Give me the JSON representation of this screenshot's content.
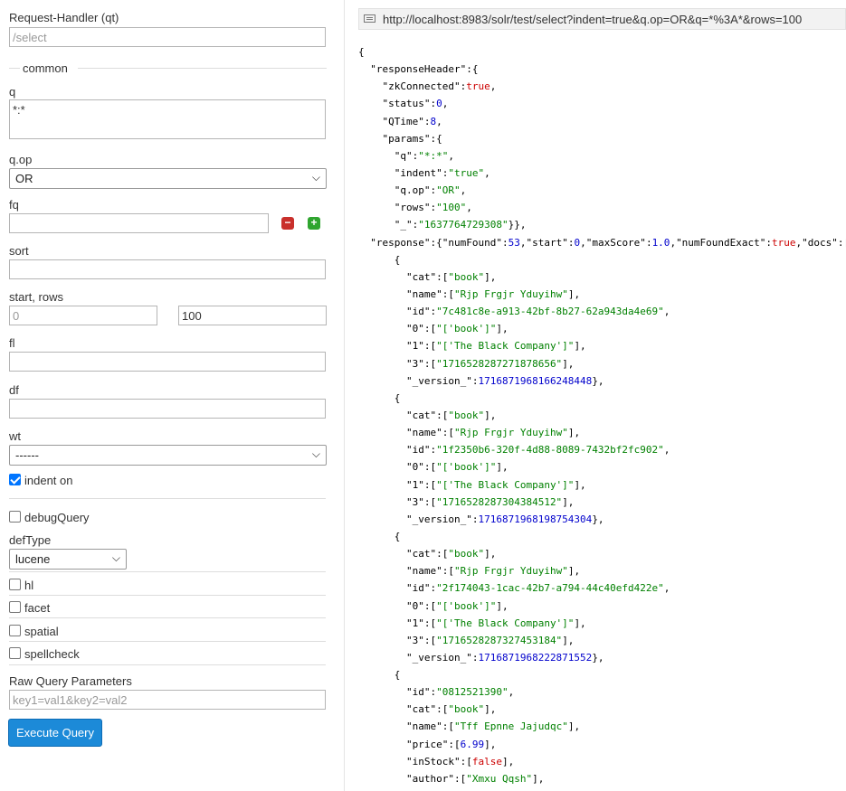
{
  "form": {
    "request_handler_label": "Request-Handler (qt)",
    "request_handler_value": "/select",
    "common_label": "common",
    "q_label": "q",
    "q_value": "*:*",
    "qop_label": "q.op",
    "qop_selected": "OR",
    "fq_label": "fq",
    "sort_label": "sort",
    "start_rows_label": "start, rows",
    "start_value": "0",
    "rows_value": "100",
    "fl_label": "fl",
    "df_label": "df",
    "wt_label": "wt",
    "wt_selected": "------",
    "indent_label": "indent on",
    "indent_checked": true,
    "debug_label": "debugQuery",
    "deftype_label": "defType",
    "deftype_selected": "lucene",
    "hl_label": "hl",
    "facet_label": "facet",
    "spatial_label": "spatial",
    "spellcheck_label": "spellcheck",
    "raw_params_label": "Raw Query Parameters",
    "raw_params_placeholder": "key1=val1&key2=val2",
    "execute_label": "Execute Query"
  },
  "response": {
    "url": "http://localhost:8983/solr/test/select?indent=true&q.op=OR&q=*%3A*&rows=100",
    "lines": [
      [
        [
          "p",
          "{"
        ]
      ],
      [
        [
          "p",
          "  "
        ],
        [
          "k",
          "\"responseHeader\""
        ],
        [
          "p",
          ":{"
        ]
      ],
      [
        [
          "p",
          "    "
        ],
        [
          "k",
          "\"zkConnected\""
        ],
        [
          "p",
          ":"
        ],
        [
          "b",
          "true"
        ],
        [
          "p",
          ","
        ]
      ],
      [
        [
          "p",
          "    "
        ],
        [
          "k",
          "\"status\""
        ],
        [
          "p",
          ":"
        ],
        [
          "n",
          "0"
        ],
        [
          "p",
          ","
        ]
      ],
      [
        [
          "p",
          "    "
        ],
        [
          "k",
          "\"QTime\""
        ],
        [
          "p",
          ":"
        ],
        [
          "n",
          "8"
        ],
        [
          "p",
          ","
        ]
      ],
      [
        [
          "p",
          "    "
        ],
        [
          "k",
          "\"params\""
        ],
        [
          "p",
          ":{"
        ]
      ],
      [
        [
          "p",
          "      "
        ],
        [
          "k",
          "\"q\""
        ],
        [
          "p",
          ":"
        ],
        [
          "s",
          "\"*:*\""
        ],
        [
          "p",
          ","
        ]
      ],
      [
        [
          "p",
          "      "
        ],
        [
          "k",
          "\"indent\""
        ],
        [
          "p",
          ":"
        ],
        [
          "s",
          "\"true\""
        ],
        [
          "p",
          ","
        ]
      ],
      [
        [
          "p",
          "      "
        ],
        [
          "k",
          "\"q.op\""
        ],
        [
          "p",
          ":"
        ],
        [
          "s",
          "\"OR\""
        ],
        [
          "p",
          ","
        ]
      ],
      [
        [
          "p",
          "      "
        ],
        [
          "k",
          "\"rows\""
        ],
        [
          "p",
          ":"
        ],
        [
          "s",
          "\"100\""
        ],
        [
          "p",
          ","
        ]
      ],
      [
        [
          "p",
          "      "
        ],
        [
          "k",
          "\"_\""
        ],
        [
          "p",
          ":"
        ],
        [
          "s",
          "\"1637764729308\""
        ],
        [
          "p",
          "}},"
        ]
      ],
      [
        [
          "p",
          "  "
        ],
        [
          "k",
          "\"response\""
        ],
        [
          "p",
          ":{"
        ],
        [
          "k",
          "\"numFound\""
        ],
        [
          "p",
          ":"
        ],
        [
          "n",
          "53"
        ],
        [
          "p",
          ","
        ],
        [
          "k",
          "\"start\""
        ],
        [
          "p",
          ":"
        ],
        [
          "n",
          "0"
        ],
        [
          "p",
          ","
        ],
        [
          "k",
          "\"maxScore\""
        ],
        [
          "p",
          ":"
        ],
        [
          "n",
          "1.0"
        ],
        [
          "p",
          ","
        ],
        [
          "k",
          "\"numFoundExact\""
        ],
        [
          "p",
          ":"
        ],
        [
          "b",
          "true"
        ],
        [
          "p",
          ","
        ],
        [
          "k",
          "\"docs\""
        ],
        [
          "p",
          ":["
        ]
      ],
      [
        [
          "p",
          "      {"
        ]
      ],
      [
        [
          "p",
          "        "
        ],
        [
          "k",
          "\"cat\""
        ],
        [
          "p",
          ":["
        ],
        [
          "s",
          "\"book\""
        ],
        [
          "p",
          "],"
        ]
      ],
      [
        [
          "p",
          "        "
        ],
        [
          "k",
          "\"name\""
        ],
        [
          "p",
          ":["
        ],
        [
          "s",
          "\"Rjp Frgjr Yduyihw\""
        ],
        [
          "p",
          "],"
        ]
      ],
      [
        [
          "p",
          "        "
        ],
        [
          "k",
          "\"id\""
        ],
        [
          "p",
          ":"
        ],
        [
          "s",
          "\"7c481c8e-a913-42bf-8b27-62a943da4e69\""
        ],
        [
          "p",
          ","
        ]
      ],
      [
        [
          "p",
          "        "
        ],
        [
          "k",
          "\"0\""
        ],
        [
          "p",
          ":["
        ],
        [
          "s",
          "\"['book']\""
        ],
        [
          "p",
          "],"
        ]
      ],
      [
        [
          "p",
          "        "
        ],
        [
          "k",
          "\"1\""
        ],
        [
          "p",
          ":["
        ],
        [
          "s",
          "\"['The Black Company']\""
        ],
        [
          "p",
          "],"
        ]
      ],
      [
        [
          "p",
          "        "
        ],
        [
          "k",
          "\"3\""
        ],
        [
          "p",
          ":["
        ],
        [
          "s",
          "\"1716528287271878656\""
        ],
        [
          "p",
          "],"
        ]
      ],
      [
        [
          "p",
          "        "
        ],
        [
          "k",
          "\"_version_\""
        ],
        [
          "p",
          ":"
        ],
        [
          "n",
          "1716871968166248448"
        ],
        [
          "p",
          "},"
        ]
      ],
      [
        [
          "p",
          "      {"
        ]
      ],
      [
        [
          "p",
          "        "
        ],
        [
          "k",
          "\"cat\""
        ],
        [
          "p",
          ":["
        ],
        [
          "s",
          "\"book\""
        ],
        [
          "p",
          "],"
        ]
      ],
      [
        [
          "p",
          "        "
        ],
        [
          "k",
          "\"name\""
        ],
        [
          "p",
          ":["
        ],
        [
          "s",
          "\"Rjp Frgjr Yduyihw\""
        ],
        [
          "p",
          "],"
        ]
      ],
      [
        [
          "p",
          "        "
        ],
        [
          "k",
          "\"id\""
        ],
        [
          "p",
          ":"
        ],
        [
          "s",
          "\"1f2350b6-320f-4d88-8089-7432bf2fc902\""
        ],
        [
          "p",
          ","
        ]
      ],
      [
        [
          "p",
          "        "
        ],
        [
          "k",
          "\"0\""
        ],
        [
          "p",
          ":["
        ],
        [
          "s",
          "\"['book']\""
        ],
        [
          "p",
          "],"
        ]
      ],
      [
        [
          "p",
          "        "
        ],
        [
          "k",
          "\"1\""
        ],
        [
          "p",
          ":["
        ],
        [
          "s",
          "\"['The Black Company']\""
        ],
        [
          "p",
          "],"
        ]
      ],
      [
        [
          "p",
          "        "
        ],
        [
          "k",
          "\"3\""
        ],
        [
          "p",
          ":["
        ],
        [
          "s",
          "\"1716528287304384512\""
        ],
        [
          "p",
          "],"
        ]
      ],
      [
        [
          "p",
          "        "
        ],
        [
          "k",
          "\"_version_\""
        ],
        [
          "p",
          ":"
        ],
        [
          "n",
          "1716871968198754304"
        ],
        [
          "p",
          "},"
        ]
      ],
      [
        [
          "p",
          "      {"
        ]
      ],
      [
        [
          "p",
          "        "
        ],
        [
          "k",
          "\"cat\""
        ],
        [
          "p",
          ":["
        ],
        [
          "s",
          "\"book\""
        ],
        [
          "p",
          "],"
        ]
      ],
      [
        [
          "p",
          "        "
        ],
        [
          "k",
          "\"name\""
        ],
        [
          "p",
          ":["
        ],
        [
          "s",
          "\"Rjp Frgjr Yduyihw\""
        ],
        [
          "p",
          "],"
        ]
      ],
      [
        [
          "p",
          "        "
        ],
        [
          "k",
          "\"id\""
        ],
        [
          "p",
          ":"
        ],
        [
          "s",
          "\"2f174043-1cac-42b7-a794-44c40efd422e\""
        ],
        [
          "p",
          ","
        ]
      ],
      [
        [
          "p",
          "        "
        ],
        [
          "k",
          "\"0\""
        ],
        [
          "p",
          ":["
        ],
        [
          "s",
          "\"['book']\""
        ],
        [
          "p",
          "],"
        ]
      ],
      [
        [
          "p",
          "        "
        ],
        [
          "k",
          "\"1\""
        ],
        [
          "p",
          ":["
        ],
        [
          "s",
          "\"['The Black Company']\""
        ],
        [
          "p",
          "],"
        ]
      ],
      [
        [
          "p",
          "        "
        ],
        [
          "k",
          "\"3\""
        ],
        [
          "p",
          ":["
        ],
        [
          "s",
          "\"1716528287327453184\""
        ],
        [
          "p",
          "],"
        ]
      ],
      [
        [
          "p",
          "        "
        ],
        [
          "k",
          "\"_version_\""
        ],
        [
          "p",
          ":"
        ],
        [
          "n",
          "1716871968222871552"
        ],
        [
          "p",
          "},"
        ]
      ],
      [
        [
          "p",
          "      {"
        ]
      ],
      [
        [
          "p",
          "        "
        ],
        [
          "k",
          "\"id\""
        ],
        [
          "p",
          ":"
        ],
        [
          "s",
          "\"0812521390\""
        ],
        [
          "p",
          ","
        ]
      ],
      [
        [
          "p",
          "        "
        ],
        [
          "k",
          "\"cat\""
        ],
        [
          "p",
          ":["
        ],
        [
          "s",
          "\"book\""
        ],
        [
          "p",
          "],"
        ]
      ],
      [
        [
          "p",
          "        "
        ],
        [
          "k",
          "\"name\""
        ],
        [
          "p",
          ":["
        ],
        [
          "s",
          "\"Tff Epnne Jajudqc\""
        ],
        [
          "p",
          "],"
        ]
      ],
      [
        [
          "p",
          "        "
        ],
        [
          "k",
          "\"price\""
        ],
        [
          "p",
          ":["
        ],
        [
          "n",
          "6.99"
        ],
        [
          "p",
          "],"
        ]
      ],
      [
        [
          "p",
          "        "
        ],
        [
          "k",
          "\"inStock\""
        ],
        [
          "p",
          ":["
        ],
        [
          "b",
          "false"
        ],
        [
          "p",
          "],"
        ]
      ],
      [
        [
          "p",
          "        "
        ],
        [
          "k",
          "\"author\""
        ],
        [
          "p",
          ":["
        ],
        [
          "s",
          "\"Xmxu Qqsh\""
        ],
        [
          "p",
          "],"
        ]
      ]
    ]
  },
  "colors": {
    "json_string": "#008000",
    "json_number": "#0000cc",
    "json_boolean": "#cc0000",
    "execute_button": "#1c8ad8",
    "fq_remove": "#c9302c",
    "fq_add": "#2fa52f"
  },
  "icons": {
    "url_icon": "document-icon",
    "fq_remove": "minus-icon",
    "fq_add": "plus-icon"
  }
}
